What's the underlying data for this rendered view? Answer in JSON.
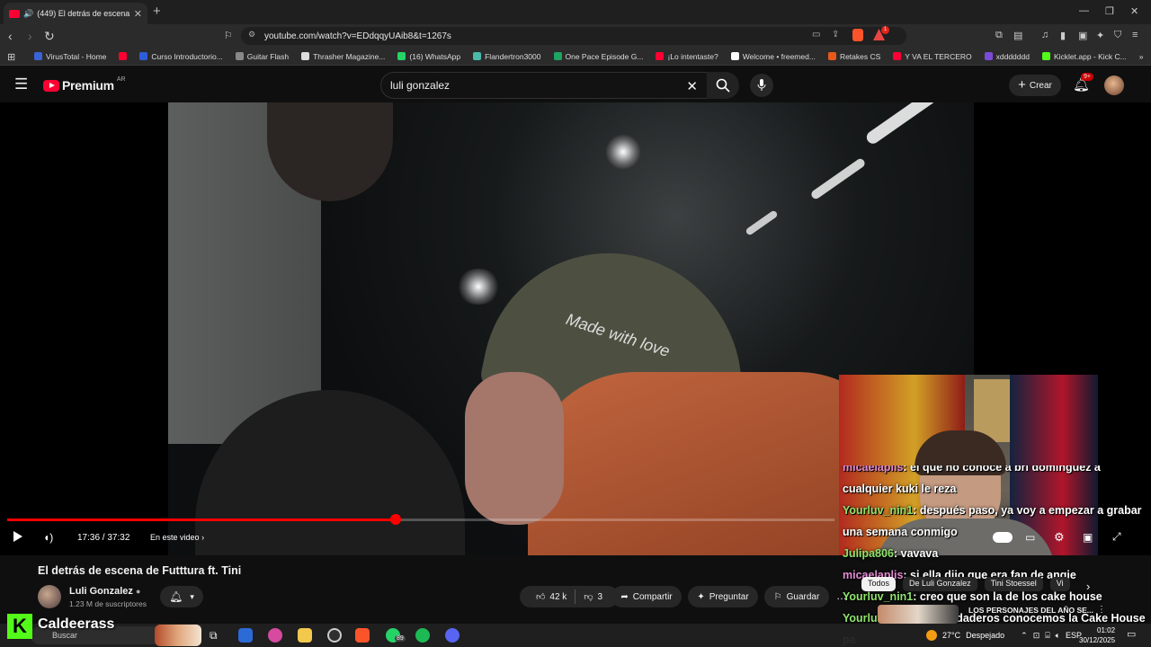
{
  "browser": {
    "tab_title": "(449) El detrás de escena de F",
    "url": "youtube.com/watch?v=EDdqqyUAib8&t=1267s",
    "bookmarks": [
      {
        "label": "VirusTotal - Home",
        "color": "#3b62d6"
      },
      {
        "label": "",
        "color": "#ff0033"
      },
      {
        "label": "Curso Introductorio...",
        "color": "#2f5dd6"
      },
      {
        "label": "Guitar Flash",
        "color": "#888"
      },
      {
        "label": "Thrasher Magazine...",
        "color": "#ddd"
      },
      {
        "label": "(16) WhatsApp",
        "color": "#25d366"
      },
      {
        "label": "Flandertron3000",
        "color": "#4bb9a8"
      },
      {
        "label": "One Pace Episode G...",
        "color": "#1ea362"
      },
      {
        "label": "¡Lo intentaste?",
        "color": "#ff0033"
      },
      {
        "label": "Welcome • freemed...",
        "color": "#fff"
      },
      {
        "label": "Retakes CS",
        "color": "#e85a1a"
      },
      {
        "label": "Y VA EL TERCERO",
        "color": "#ff0033"
      },
      {
        "label": "xddddddd",
        "color": "#7a4bd6"
      },
      {
        "label": "Kicklet.app - Kick C...",
        "color": "#53fc18"
      }
    ],
    "notification_badge": "1"
  },
  "youtube": {
    "logo_text": "Premium",
    "country": "AR",
    "search_value": "luli gonzalez",
    "create_label": "Crear",
    "notifications_badge": "9+"
  },
  "player": {
    "progress": 0.4696,
    "time": "17:36 / 37:32",
    "chapter_label": "En este video"
  },
  "video": {
    "title": "El detrás de escena de Futttura ft. Tini",
    "channel": "Luli Gonzalez",
    "subscribers": "1.23 M de suscriptores",
    "likes": "42 k",
    "dislikes": "3",
    "share_label": "Compartir",
    "ask_label": "Preguntar",
    "save_label": "Guardar"
  },
  "overlay_text": {
    "cap_embroidery": "Made with love"
  },
  "chips": [
    "Todos",
    "De Luli Gonzalez",
    "Tini Stoessel",
    "Vi"
  ],
  "recommendation_title": "LOS PERSONAJES DEL AÑO SE...",
  "chat": [
    {
      "user": "micaelaplis",
      "color": "pink",
      "msg": ": el que no conoce a bri dominguez a cualquier kuki le reza"
    },
    {
      "user": "Yourluv_nin1",
      "color": "green",
      "msg": ": después paso, ya voy a empezar a grabar una semana conmigo"
    },
    {
      "user": "Julipa806",
      "color": "green",
      "msg": ": vavava"
    },
    {
      "user": "micaelaplis",
      "color": "pink",
      "msg": ": si ella dijo que era fan de angie"
    },
    {
      "user": "Yourluv_nin1",
      "color": "green",
      "msg": ": creo que son la de los cake house"
    },
    {
      "user": "Yourluv_nin1",
      "color": "green",
      "msg": ": los verdaderos conocemos la Cake House pa"
    }
  ],
  "streamer": {
    "logo_letter": "K",
    "name": "Caldeerass"
  },
  "taskbar": {
    "search_label": "Buscar",
    "whatsapp_badge": "89",
    "weather": "27°C",
    "weather_desc": "Despejado",
    "lang": "ESP",
    "time": "01:02",
    "date": "30/12/2025"
  }
}
